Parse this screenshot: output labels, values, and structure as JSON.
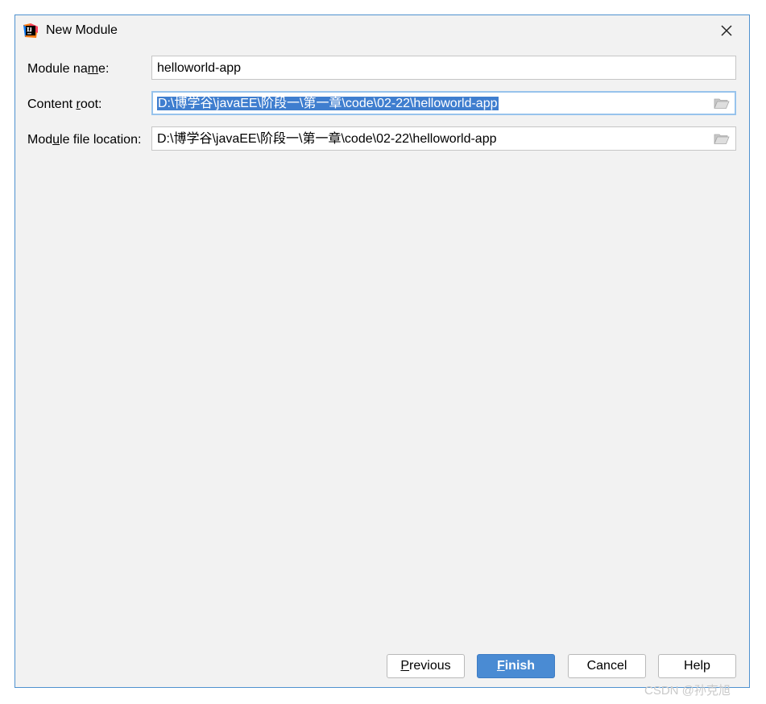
{
  "window": {
    "title": "New Module"
  },
  "form": {
    "module_name": {
      "label_pre": "Module na",
      "label_u": "m",
      "label_post": "e:",
      "value": "helloworld-app"
    },
    "content_root": {
      "label_pre": "Content ",
      "label_u": "r",
      "label_post": "oot:",
      "value": "D:\\博学谷\\javaEE\\阶段一\\第一章\\code\\02-22\\helloworld-app"
    },
    "module_file_location": {
      "label_pre": "Mod",
      "label_u": "u",
      "label_post": "le file location:",
      "value": "D:\\博学谷\\javaEE\\阶段一\\第一章\\code\\02-22\\helloworld-app"
    }
  },
  "buttons": {
    "previous": {
      "u": "P",
      "rest": "revious"
    },
    "finish": {
      "u": "F",
      "rest": "inish"
    },
    "cancel": "Cancel",
    "help": "Help"
  },
  "watermark": "CSDN @孙克旭",
  "icons": {
    "app": "intellij-idea-icon",
    "close": "close-icon",
    "browse": "folder-icon"
  },
  "colors": {
    "accent": "#4a8bd3",
    "selection": "#3f7ecf",
    "focus_border": "#97c3ec",
    "dialog_border": "#4f91cf"
  }
}
